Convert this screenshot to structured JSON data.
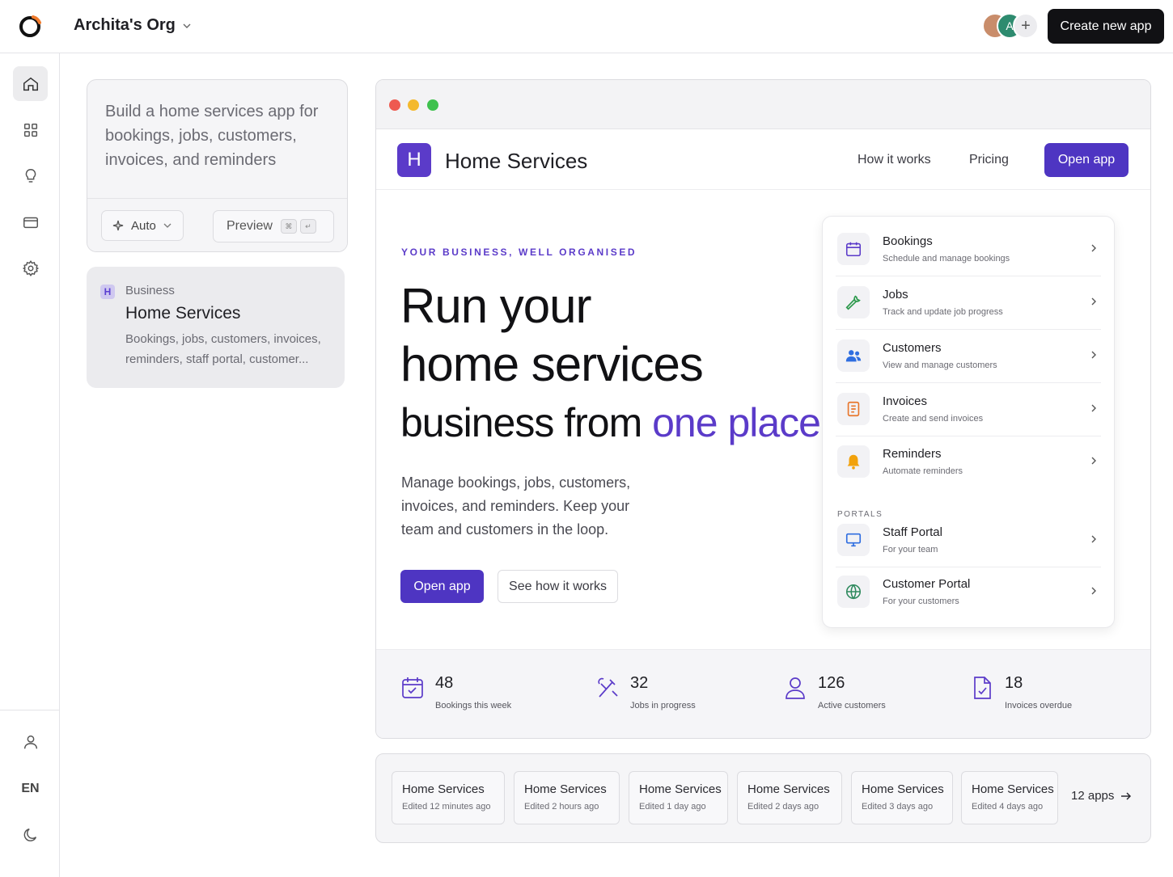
{
  "header": {
    "org_name": "Archita's Org",
    "avatar_letter": "A",
    "add_member_symbol": "+",
    "create_button": "Create new app"
  },
  "sidebar": {
    "items": [
      {
        "icon": "home-icon",
        "active": true
      },
      {
        "icon": "grid-icon"
      },
      {
        "icon": "lightbulb-icon"
      },
      {
        "icon": "card-icon"
      },
      {
        "icon": "gear-icon"
      }
    ],
    "bottom": {
      "profile_icon": "user-icon",
      "language": "EN",
      "theme_icon": "moon-icon"
    }
  },
  "prompt": {
    "text": "Build a home services app for bookings, jobs, customers, invoices, and reminders",
    "mode_label": "Auto",
    "preview_label": "Preview",
    "kbd_1": "⌘",
    "kbd_2": "↵"
  },
  "project": {
    "badge": "H",
    "category": "Business",
    "title": "Home Services",
    "description": "Bookings, jobs, customers, invoices, reminders, staff portal, customer..."
  },
  "app_preview": {
    "logo_letter": "H",
    "name": "Home Services",
    "nav": {
      "how_it_works": "How it works",
      "pricing": "Pricing",
      "open_app": "Open app"
    },
    "eyebrow": "YOUR BUSINESS, WELL ORGANISED",
    "headline_1": "Run your",
    "headline_2": "home services",
    "headline_3a": "business from ",
    "headline_3b": "one place.",
    "subtext": "Manage bookings, jobs, customers, invoices, and reminders. Keep your team and customers in the loop.",
    "cta_primary": "Open app",
    "cta_secondary": "See how it works",
    "accent_color": "#5b3bc9",
    "modules": [
      {
        "title": "Bookings",
        "subtitle": "Schedule and manage bookings",
        "icon": "calendar-icon"
      },
      {
        "title": "Jobs",
        "subtitle": "Track and update job progress",
        "icon": "wrench-icon"
      },
      {
        "title": "Customers",
        "subtitle": "View and manage customers",
        "icon": "users-icon"
      },
      {
        "title": "Invoices",
        "subtitle": "Create and send invoices",
        "icon": "invoice-icon"
      },
      {
        "title": "Reminders",
        "subtitle": "Automate reminders",
        "icon": "bell-icon"
      }
    ],
    "portals_label": "PORTALS",
    "portals": [
      {
        "title": "Staff Portal",
        "subtitle": "For your team",
        "icon": "monitor-icon"
      },
      {
        "title": "Customer Portal",
        "subtitle": "For your customers",
        "icon": "globe-icon"
      }
    ],
    "stats": [
      {
        "value": "48",
        "label": "Bookings this week",
        "icon": "calendar-icon"
      },
      {
        "value": "32",
        "label": "Jobs in progress",
        "icon": "tools-icon"
      },
      {
        "value": "126",
        "label": "Active customers",
        "icon": "user-icon"
      },
      {
        "value": "18",
        "label": "Invoices overdue",
        "icon": "document-icon"
      }
    ]
  },
  "recent_apps": {
    "items": [
      {
        "title": "Home Services",
        "edited": "Edited 12 minutes ago"
      },
      {
        "title": "Home Services",
        "edited": "Edited 2 hours ago"
      },
      {
        "title": "Home Services",
        "edited": "Edited 1 day ago"
      },
      {
        "title": "Home Services",
        "edited": "Edited 2 days ago"
      },
      {
        "title": "Home Services",
        "edited": "Edited 3 days ago"
      },
      {
        "title": "Home Services",
        "edited": "Edited 4 days ago"
      }
    ],
    "more_label": "12 apps"
  }
}
